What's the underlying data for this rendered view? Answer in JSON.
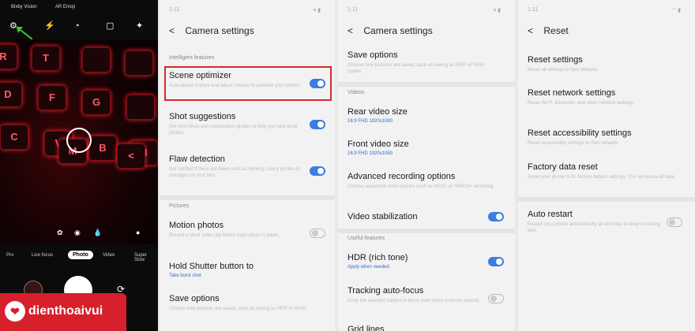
{
  "camera": {
    "top_labels": [
      "Bixby Vision",
      "AR Emoji"
    ],
    "modes": [
      "Pro",
      "Live focus",
      "Photo",
      "Video",
      "Super Slow"
    ],
    "keys": [
      "R",
      "T",
      "D",
      "F",
      "G",
      "C",
      "V",
      "B",
      "N",
      "M",
      "<",
      "K"
    ]
  },
  "brand": {
    "name": "dienthoaivui"
  },
  "panel2": {
    "time": "1:11",
    "title": "Camera settings",
    "section_intelligent": "Intelligent features",
    "section_pictures": "Pictures",
    "items": [
      {
        "title": "Scene optimizer",
        "desc": "Auto-detect scenes and adjust colours to optimise your photos.",
        "toggle": "on"
      },
      {
        "title": "Shot suggestions",
        "desc": "Get shot ideas and composition guides to help you take great photos.",
        "toggle": "on"
      },
      {
        "title": "Flaw detection",
        "desc": "Get notified if there are flaws such as blinking, blurry photos or smudges on your lens.",
        "toggle": "on"
      },
      {
        "title": "Motion photos",
        "desc": "Record a short video clip before each photo is taken.",
        "toggle": "off"
      },
      {
        "title": "Hold Shutter button to",
        "value": "Take burst shot"
      },
      {
        "title": "Save options",
        "desc": "Choose how pictures are saved, such as saving as HEIF or RAW."
      }
    ]
  },
  "panel3": {
    "time": "1:11",
    "title": "Camera settings",
    "section_videos": "Videos",
    "section_useful": "Useful features",
    "items": [
      {
        "title": "Save options",
        "desc": "Choose how pictures are saved, such as saving as HEIF or RAW copies."
      },
      {
        "title": "Rear video size",
        "value": "16:9 FHD 1920x1080"
      },
      {
        "title": "Front video size",
        "value": "16:9 FHD 1920x1080"
      },
      {
        "title": "Advanced recording options",
        "desc": "Choose advanced video options such as HEVC or HDR10+ recording."
      },
      {
        "title": "Video stabilization",
        "toggle": "on"
      },
      {
        "title": "HDR (rich tone)",
        "value": "Apply when needed",
        "toggle": "on"
      },
      {
        "title": "Tracking auto-focus",
        "desc": "Keep the selected subject in focus even when it moves around.",
        "toggle": "off"
      },
      {
        "title": "Grid lines"
      }
    ]
  },
  "panel4": {
    "time": "1:11",
    "title": "Reset",
    "items": [
      {
        "title": "Reset settings",
        "desc": "Reset all settings to their defaults."
      },
      {
        "title": "Reset network settings",
        "desc": "Reset Wi-Fi, Bluetooth, and other network settings."
      },
      {
        "title": "Reset accessibility settings",
        "desc": "Reset accessibility settings to their defaults."
      },
      {
        "title": "Factory data reset",
        "desc": "Reset your phone to its factory default settings. This will erase all data."
      },
      {
        "title": "Auto restart",
        "desc": "Restart your phone automatically at set times to keep it running well.",
        "toggle": "off"
      }
    ]
  },
  "colors": {
    "accent": "#3b7de0",
    "highlight": "#d12a2f",
    "brand": "#d6202b"
  },
  "icons": [
    "gear-icon",
    "flash-off-icon",
    "timer-icon",
    "ratio-icon",
    "magic-icon",
    "back-arrow-icon",
    "wifi-icon",
    "battery-icon",
    "switch-camera-icon"
  ]
}
